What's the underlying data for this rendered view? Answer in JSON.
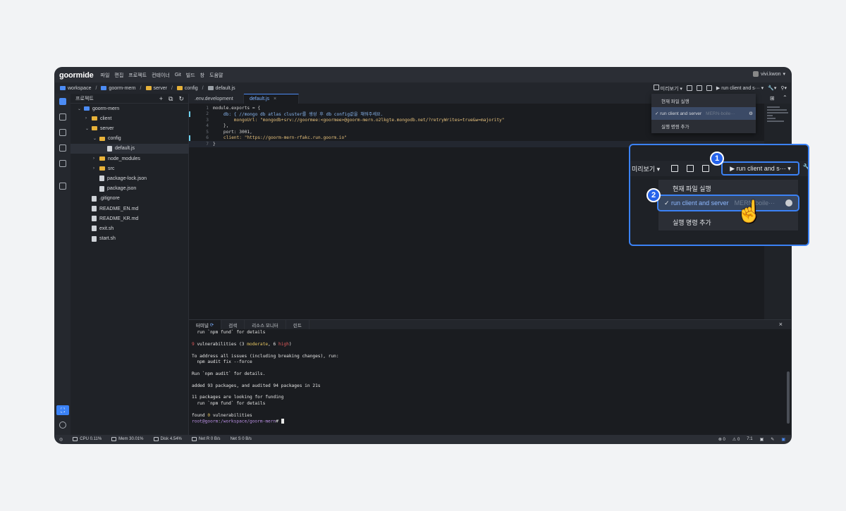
{
  "menubar": {
    "logo": "goormide",
    "items": [
      "파일",
      "편집",
      "프로젝트",
      "컨테이너",
      "Git",
      "빌드",
      "창",
      "도움말"
    ],
    "user": "vivi.kwon"
  },
  "breadcrumb": [
    "workspace",
    "goorm-mern",
    "server",
    "config",
    "default.js"
  ],
  "toolbar": {
    "preview": "미리보기",
    "run_label": "run client and s···"
  },
  "sidebar": {
    "title": "프로젝트",
    "tree": [
      {
        "label": "goorm-mern",
        "kind": "root",
        "depth": 0,
        "open": true
      },
      {
        "label": "client",
        "kind": "folder",
        "depth": 1,
        "open": false
      },
      {
        "label": "server",
        "kind": "folder",
        "depth": 1,
        "open": true
      },
      {
        "label": "config",
        "kind": "folder",
        "depth": 2,
        "open": true
      },
      {
        "label": "default.js",
        "kind": "file",
        "depth": 3,
        "selected": true
      },
      {
        "label": "node_modules",
        "kind": "folder",
        "depth": 2,
        "open": false
      },
      {
        "label": "src",
        "kind": "folder",
        "depth": 2,
        "open": false
      },
      {
        "label": "package-lock.json",
        "kind": "file",
        "depth": 2
      },
      {
        "label": "package.json",
        "kind": "file",
        "depth": 2
      },
      {
        "label": ".gitignore",
        "kind": "file",
        "depth": 1
      },
      {
        "label": "README_EN.md",
        "kind": "file",
        "depth": 1
      },
      {
        "label": "README_KR.md",
        "kind": "file",
        "depth": 1
      },
      {
        "label": "exit.sh",
        "kind": "file",
        "depth": 1
      },
      {
        "label": "start.sh",
        "kind": "file",
        "depth": 1
      }
    ]
  },
  "editor": {
    "tabs": [
      {
        "label": ".env.development",
        "active": false
      },
      {
        "label": "default.js",
        "active": true
      }
    ],
    "lines": [
      {
        "n": "1",
        "text": "module.exports = {"
      },
      {
        "n": "2",
        "text": "    db: { //mongo db atlas cluster를 생성 후 db config값을 채워주세요."
      },
      {
        "n": "3",
        "text": "        mongoUrl: \"mongodb+srv://goormee:<goormee>@goorm-mern.o2lkgte.mongodb.net/?retryWrites=true&w=majority\""
      },
      {
        "n": "4",
        "text": "    },"
      },
      {
        "n": "5",
        "text": "    port: 3001,"
      },
      {
        "n": "6",
        "text": "    client: \"https://goorm-mern-rfakc.run.goorm.io\""
      },
      {
        "n": "7",
        "text": "}"
      }
    ]
  },
  "run_menu": {
    "items": [
      "현재 파일 실행",
      "run client and server",
      "실행 명령 추가"
    ],
    "selected_index": 1,
    "selected_suffix": "MERN-boile···"
  },
  "terminal": {
    "tabs": [
      "터미널",
      "검색",
      "리소스 모니터",
      "린트"
    ],
    "lines": [
      {
        "text": "  run `npm fund` for details"
      },
      {
        "text": ""
      },
      {
        "parts": [
          [
            "9",
            "red"
          ],
          [
            " vulnerabilities (3 ",
            ""
          ],
          [
            "moderate",
            "yellow"
          ],
          [
            ", 6 ",
            ""
          ],
          [
            "high",
            "red"
          ],
          [
            ")",
            ""
          ]
        ]
      },
      {
        "text": ""
      },
      {
        "text": "To address all issues (including breaking changes), run:"
      },
      {
        "text": "  npm audit fix --force"
      },
      {
        "text": ""
      },
      {
        "text": "Run `npm audit` for details."
      },
      {
        "text": ""
      },
      {
        "text": "added 93 packages, and audited 94 packages in 21s"
      },
      {
        "text": ""
      },
      {
        "text": "11 packages are looking for funding"
      },
      {
        "text": "  run `npm fund` for details"
      },
      {
        "text": ""
      },
      {
        "parts": [
          [
            "found ",
            ""
          ],
          [
            "0",
            "yellow"
          ],
          [
            " vulnerabilities",
            ""
          ]
        ]
      },
      {
        "parts": [
          [
            "root@goorm",
            "purple"
          ],
          [
            ":",
            ""
          ],
          [
            "/workspace/goorm-mern",
            "purple"
          ],
          [
            "# ",
            ""
          ]
        ]
      }
    ]
  },
  "status": {
    "cpu": "CPU 0.11%",
    "mem": "Mem 30.01%",
    "disk": "Disk 4.54%",
    "net_r": "Net R 0 B/s",
    "net_s": "Net S 0 B/s",
    "errors": "0",
    "warnings": "0",
    "position": "7:1"
  },
  "callout": {
    "badge1": "1",
    "badge2": "2"
  },
  "colors": {
    "accent": "#3b82f6",
    "bg": "#1e2126"
  }
}
